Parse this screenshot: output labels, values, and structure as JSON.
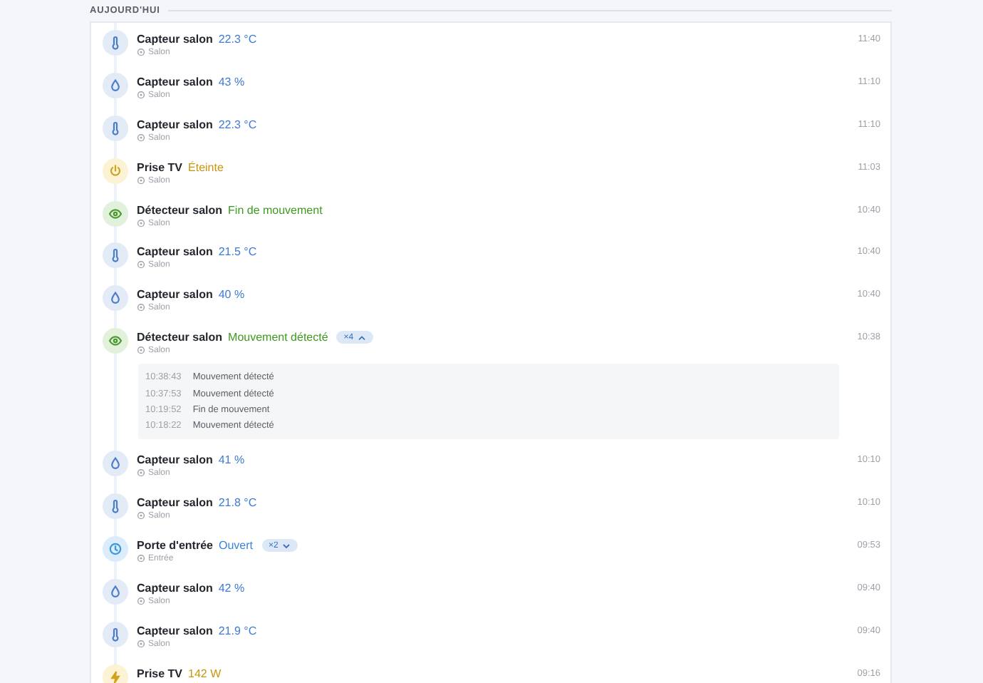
{
  "section": {
    "title": "AUJOURD'HUI"
  },
  "events": [
    {
      "kind": "temperature",
      "title": "Capteur salon",
      "value": "22.3 °C",
      "location": "Salon",
      "time": "11:40"
    },
    {
      "kind": "humidity",
      "title": "Capteur salon",
      "value": "43 %",
      "location": "Salon",
      "time": "11:10"
    },
    {
      "kind": "temperature",
      "title": "Capteur salon",
      "value": "22.3 °C",
      "location": "Salon",
      "time": "11:10"
    },
    {
      "kind": "power",
      "title": "Prise TV",
      "value": "Éteinte",
      "location": "Salon",
      "time": "11:03"
    },
    {
      "kind": "motion",
      "title": "Détecteur salon",
      "value": "Fin de mouvement",
      "location": "Salon",
      "time": "10:40"
    },
    {
      "kind": "temperature",
      "title": "Capteur salon",
      "value": "21.5 °C",
      "location": "Salon",
      "time": "10:40"
    },
    {
      "kind": "humidity",
      "title": "Capteur salon",
      "value": "40 %",
      "location": "Salon",
      "time": "10:40"
    },
    {
      "kind": "motion",
      "title": "Détecteur salon",
      "value": "Mouvement détecté",
      "location": "Salon",
      "time": "10:38",
      "count": "×4",
      "expanded": true,
      "details": [
        {
          "time": "10:38:43",
          "text": "Mouvement détecté"
        },
        {
          "time": "10:37:53",
          "text": "Mouvement détecté"
        },
        {
          "time": "10:19:52",
          "text": "Fin de mouvement"
        },
        {
          "time": "10:18:22",
          "text": "Mouvement détecté"
        }
      ]
    },
    {
      "kind": "humidity",
      "title": "Capteur salon",
      "value": "41 %",
      "location": "Salon",
      "time": "10:10"
    },
    {
      "kind": "temperature",
      "title": "Capteur salon",
      "value": "21.8 °C",
      "location": "Salon",
      "time": "10:10"
    },
    {
      "kind": "door",
      "title": "Porte d'entrée",
      "value": "Ouvert",
      "location": "Entrée",
      "time": "09:53",
      "count": "×2",
      "expanded": false
    },
    {
      "kind": "humidity",
      "title": "Capteur salon",
      "value": "42 %",
      "location": "Salon",
      "time": "09:40"
    },
    {
      "kind": "temperature",
      "title": "Capteur salon",
      "value": "21.9 °C",
      "location": "Salon",
      "time": "09:40"
    },
    {
      "kind": "energy",
      "title": "Prise TV",
      "value": "142 W",
      "time": "09:16"
    }
  ]
}
